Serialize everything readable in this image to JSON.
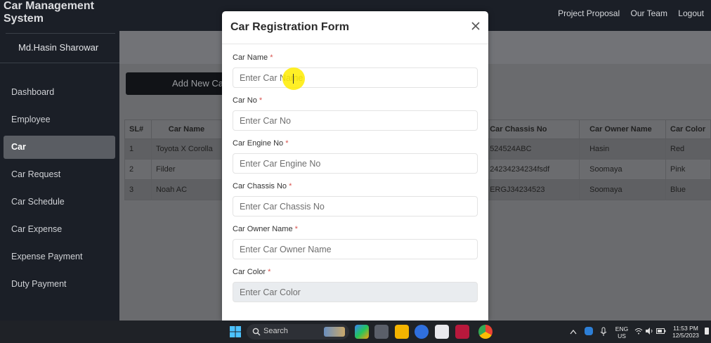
{
  "app": {
    "title": "Car Management System",
    "user_name": "Md.Hasin Sharowar"
  },
  "topnav": [
    "Project Proposal",
    "Our Team",
    "Logout"
  ],
  "sidebar": {
    "items": [
      {
        "label": "Dashboard"
      },
      {
        "label": "Employee"
      },
      {
        "label": "Car",
        "active": true
      },
      {
        "label": "Car Request"
      },
      {
        "label": "Car Schedule"
      },
      {
        "label": "Car Expense"
      },
      {
        "label": "Expense Payment"
      },
      {
        "label": "Duty Payment"
      }
    ]
  },
  "main": {
    "add_button_label": "Add New Ca",
    "table": {
      "headers": [
        "SL#",
        "Car Name",
        "Car Chassis No",
        "Car Owner Name",
        "Car Color"
      ],
      "rows": [
        [
          "1",
          "Toyota X Corolla",
          "524524ABC",
          "Hasin",
          "Red"
        ],
        [
          "2",
          "Filder",
          "24234234234fsdf",
          "Soomaya",
          "Pink"
        ],
        [
          "3",
          "Noah AC",
          "ERGJ34234523",
          "Soomaya",
          "Blue"
        ]
      ]
    }
  },
  "modal": {
    "title": "Car Registration Form",
    "required_mark": "*",
    "fields": [
      {
        "label": "Car Name",
        "placeholder": "Enter Car Name"
      },
      {
        "label": "Car No",
        "placeholder": "Enter Car No"
      },
      {
        "label": "Car Engine No",
        "placeholder": "Enter Car Engine No"
      },
      {
        "label": "Car Chassis No",
        "placeholder": "Enter Car Chassis No"
      },
      {
        "label": "Car Owner Name",
        "placeholder": "Enter Car Owner Name"
      },
      {
        "label": "Car Color",
        "placeholder": "Enter Car Color"
      }
    ]
  },
  "taskbar": {
    "search_label": "Search",
    "lang_line1": "ENG",
    "lang_line2": "US",
    "time": "11:53 PM",
    "date": "12/5/2023"
  },
  "colors": {
    "sidebar_bg": "#1b1f27",
    "overlay_content": "#6a6b6e",
    "required": "#d9534f",
    "cursor_highlight": "#ffec00"
  },
  "icons": [
    "close-icon",
    "windows-start-icon",
    "search-icon",
    "chevron-up-icon",
    "wifi-icon",
    "volume-icon",
    "battery-icon",
    "microphone-icon"
  ]
}
